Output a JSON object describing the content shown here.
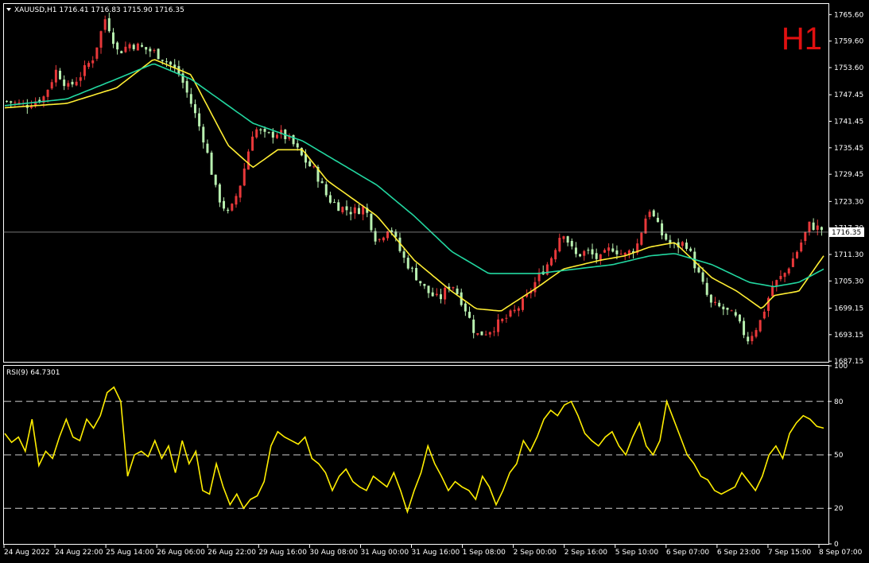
{
  "header": {
    "symbol_label": "XAUUSD,H1  1716.41 1716.83 1715.90 1716.35",
    "timeframe_badge": "H1",
    "rsi_label": "RSI(9) 64.7301",
    "current_price": "1716.35"
  },
  "colors": {
    "background": "#000000",
    "bull": "#e8383a",
    "bear": "#b8f0b0",
    "ma_fast": "#ffee33",
    "ma_slow": "#22d7a0",
    "rsi": "#ffee00",
    "grid": "#ffffff"
  },
  "chart_data": [
    {
      "type": "candlestick",
      "symbol": "XAUUSD",
      "timeframe": "H1",
      "ylim": [
        1687.0,
        1768.0
      ],
      "yticks": [
        "1765.60",
        "1759.60",
        "1753.60",
        "1747.45",
        "1741.45",
        "1735.45",
        "1729.45",
        "1723.30",
        "1717.30",
        "1711.30",
        "1705.30",
        "1699.15",
        "1693.15",
        "1687.15"
      ],
      "xticks": [
        "24 Aug 2022",
        "24 Aug 22:00",
        "25 Aug 14:00",
        "26 Aug 06:00",
        "26 Aug 22:00",
        "29 Aug 16:00",
        "30 Aug 08:00",
        "31 Aug 00:00",
        "31 Aug 16:00",
        "1 Sep 08:00",
        "2 Sep 00:00",
        "2 Sep 16:00",
        "5 Sep 10:00",
        "6 Sep 07:00",
        "6 Sep 23:00",
        "7 Sep 15:00",
        "8 Sep 07:00"
      ],
      "current_price": 1716.35,
      "close_path": [
        [
          0,
          1746
        ],
        [
          3,
          1745
        ],
        [
          6,
          1747
        ],
        [
          8,
          1753
        ],
        [
          10,
          1749
        ],
        [
          12,
          1752
        ],
        [
          14,
          1756
        ],
        [
          16,
          1765
        ],
        [
          18,
          1757
        ],
        [
          20,
          1759
        ],
        [
          22,
          1758
        ],
        [
          24,
          1757
        ],
        [
          26,
          1755
        ],
        [
          28,
          1752
        ],
        [
          30,
          1745
        ],
        [
          32,
          1737
        ],
        [
          34,
          1725
        ],
        [
          36,
          1720
        ],
        [
          38,
          1728
        ],
        [
          40,
          1740
        ],
        [
          42,
          1738
        ],
        [
          44,
          1739
        ],
        [
          46,
          1737
        ],
        [
          48,
          1733
        ],
        [
          50,
          1730
        ],
        [
          52,
          1724
        ],
        [
          54,
          1722
        ],
        [
          56,
          1721
        ],
        [
          58,
          1722
        ],
        [
          60,
          1714
        ],
        [
          62,
          1718
        ],
        [
          64,
          1711
        ],
        [
          66,
          1707
        ],
        [
          68,
          1703
        ],
        [
          70,
          1701
        ],
        [
          72,
          1705
        ],
        [
          74,
          1700
        ],
        [
          76,
          1693
        ],
        [
          78,
          1694
        ],
        [
          80,
          1696
        ],
        [
          82,
          1698
        ],
        [
          84,
          1701
        ],
        [
          86,
          1706
        ],
        [
          88,
          1710
        ],
        [
          90,
          1717
        ],
        [
          92,
          1711
        ],
        [
          94,
          1712
        ],
        [
          96,
          1710
        ],
        [
          98,
          1713
        ],
        [
          100,
          1711
        ],
        [
          102,
          1713
        ],
        [
          104,
          1722
        ],
        [
          106,
          1716
        ],
        [
          108,
          1713
        ],
        [
          110,
          1714
        ],
        [
          112,
          1707
        ],
        [
          114,
          1700
        ],
        [
          116,
          1699
        ],
        [
          118,
          1697
        ],
        [
          120,
          1692
        ],
        [
          122,
          1696
        ],
        [
          124,
          1704
        ],
        [
          126,
          1707
        ],
        [
          128,
          1712
        ],
        [
          130,
          1718
        ],
        [
          132,
          1717
        ]
      ],
      "series": [
        {
          "name": "",
          "values": [
            [
              0,
              1744.5
            ],
            [
              10,
              1745.5
            ],
            [
              18,
              1749
            ],
            [
              24,
              1755.5
            ],
            [
              30,
              1752
            ],
            [
              36,
              1736
            ],
            [
              40,
              1731
            ],
            [
              44,
              1735
            ],
            [
              48,
              1735
            ],
            [
              52,
              1728
            ],
            [
              56,
              1724
            ],
            [
              60,
              1720
            ],
            [
              66,
              1710
            ],
            [
              72,
              1703
            ],
            [
              76,
              1699
            ],
            [
              80,
              1698.5
            ],
            [
              86,
              1704
            ],
            [
              90,
              1708
            ],
            [
              96,
              1710
            ],
            [
              100,
              1711
            ],
            [
              104,
              1713
            ],
            [
              108,
              1714
            ],
            [
              114,
              1706
            ],
            [
              118,
              1703
            ],
            [
              122,
              1699
            ],
            [
              124,
              1702
            ],
            [
              128,
              1703
            ],
            [
              132,
              1711
            ]
          ]
        },
        {
          "name": "",
          "values": [
            [
              0,
              1745
            ],
            [
              10,
              1746.5
            ],
            [
              18,
              1751
            ],
            [
              24,
              1754.5
            ],
            [
              30,
              1751
            ],
            [
              36,
              1745
            ],
            [
              40,
              1741
            ],
            [
              48,
              1737
            ],
            [
              54,
              1732
            ],
            [
              60,
              1727
            ],
            [
              66,
              1720
            ],
            [
              72,
              1712
            ],
            [
              78,
              1707
            ],
            [
              86,
              1707
            ],
            [
              92,
              1708
            ],
            [
              98,
              1709
            ],
            [
              104,
              1711
            ],
            [
              108,
              1711.5
            ],
            [
              114,
              1709
            ],
            [
              120,
              1705
            ],
            [
              124,
              1704
            ],
            [
              128,
              1705
            ],
            [
              132,
              1708
            ]
          ]
        }
      ]
    },
    {
      "type": "line",
      "title": "RSI(9) 64.7301",
      "ylim": [
        0,
        100
      ],
      "yticks": [
        "100",
        "80",
        "50",
        "20",
        "0"
      ],
      "levels": [
        80,
        50,
        20
      ],
      "series": [
        {
          "name": "",
          "values": [
            62,
            57,
            60,
            52,
            70,
            44,
            52,
            48,
            60,
            70,
            60,
            58,
            70,
            65,
            72,
            85,
            88,
            80,
            38,
            50,
            52,
            49,
            58,
            48,
            55,
            40,
            58,
            45,
            52,
            30,
            28,
            45,
            32,
            22,
            28,
            20,
            25,
            27,
            35,
            55,
            63,
            60,
            58,
            56,
            60,
            48,
            45,
            40,
            30,
            38,
            42,
            35,
            32,
            30,
            38,
            35,
            32,
            40,
            30,
            18,
            30,
            40,
            55,
            45,
            38,
            30,
            35,
            32,
            30,
            25,
            38,
            32,
            22,
            30,
            40,
            45,
            58,
            52,
            60,
            70,
            75,
            72,
            78,
            80,
            72,
            62,
            58,
            55,
            60,
            63,
            55,
            50,
            60,
            68,
            55,
            50,
            58,
            80,
            70,
            60,
            50,
            45,
            38,
            36,
            30,
            28,
            30,
            32,
            40,
            35,
            30,
            38,
            50,
            55,
            48,
            62,
            68,
            72,
            70,
            66,
            65
          ]
        }
      ]
    }
  ]
}
